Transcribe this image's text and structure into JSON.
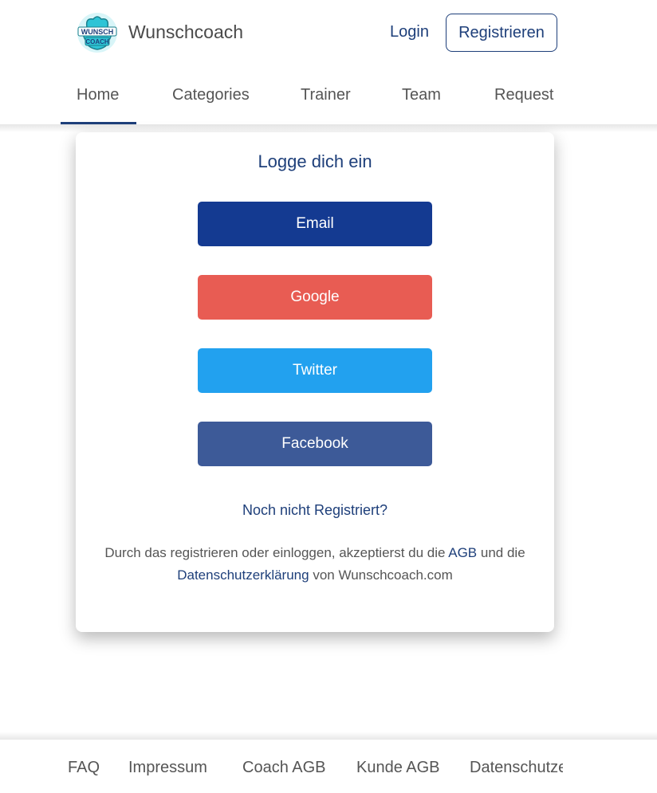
{
  "header": {
    "logo_text_top": "WUNSCH",
    "logo_text_bottom": "COACH",
    "brand": "Wunschcoach",
    "login_label": "Login",
    "register_label": "Registrieren",
    "logo_color": "#2ec4d6"
  },
  "nav": {
    "items": [
      "Home",
      "Categories",
      "Trainer",
      "Team",
      "Request"
    ],
    "active": "Home",
    "active_color": "#1e3f7a"
  },
  "login_card": {
    "title": "Logge dich ein",
    "buttons": [
      {
        "label": "Email",
        "color": "#143a91",
        "icon": "email"
      },
      {
        "label": "Google",
        "color": "#e85c53",
        "icon": "google"
      },
      {
        "label": "Twitter",
        "color": "#22a1ef",
        "icon": "twitter"
      },
      {
        "label": "Facebook",
        "color": "#3d5a98",
        "icon": "facebook"
      }
    ],
    "not_registered": "Noch nicht Registriert?",
    "terms_part1": "Durch das registrieren oder einloggen, akzeptierst du die ",
    "terms_agb": "AGB",
    "terms_part2": " und die ",
    "terms_privacy": "Datenschutzerklärung",
    "terms_part3": " von Wunschcoach.com"
  },
  "footer": {
    "items": [
      "FAQ",
      "Impressum",
      "Coach AGB",
      "Kunde AGB",
      "Datenschutzerklärung"
    ]
  }
}
